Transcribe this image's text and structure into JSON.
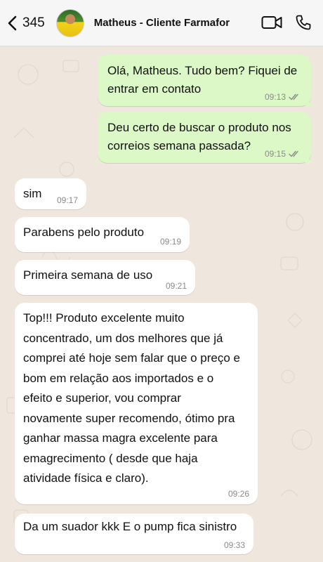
{
  "header": {
    "back_count": "345",
    "contact_name": "Matheus - Cliente Farmafor",
    "icons": [
      "back-chevron-icon",
      "video-call-icon",
      "phone-call-icon"
    ]
  },
  "messages": [
    {
      "direction": "outgoing",
      "text": "Olá, Matheus. Tudo bem? Fiquei de\nentrar em contato",
      "time": "09:13",
      "status": "read"
    },
    {
      "direction": "outgoing",
      "text": "Deu certo de buscar o produto nos\ncorreios semana passada?",
      "time": "09:15",
      "status": "read"
    },
    {
      "direction": "incoming",
      "text": "sim",
      "time": "09:17"
    },
    {
      "direction": "incoming",
      "text": "Parabens pelo produto",
      "time": "09:19"
    },
    {
      "direction": "incoming",
      "text": "Primeira semana de uso",
      "time": "09:21"
    },
    {
      "direction": "incoming",
      "text": "Top!!! Produto excelente muito\nconcentrado, um dos melhores que já\ncomprei até hoje sem falar que o preço e\nbom em relação aos importados e o\nefeito e superior, vou comprar\nnovamente super recomendo, ótimo pra\nganhar massa magra excelente para\nemagrecimento ( desde que haja\natividade física e claro).",
      "time": "09:26"
    },
    {
      "direction": "incoming",
      "text": "Da um suador kkk E o pump fica sinistro",
      "time": "09:33"
    }
  ],
  "colors": {
    "outgoing_bubble": "#dcf8c6",
    "incoming_bubble": "#ffffff",
    "wallpaper": "#efe7dd",
    "read_ticks": "#8a8a8a"
  }
}
